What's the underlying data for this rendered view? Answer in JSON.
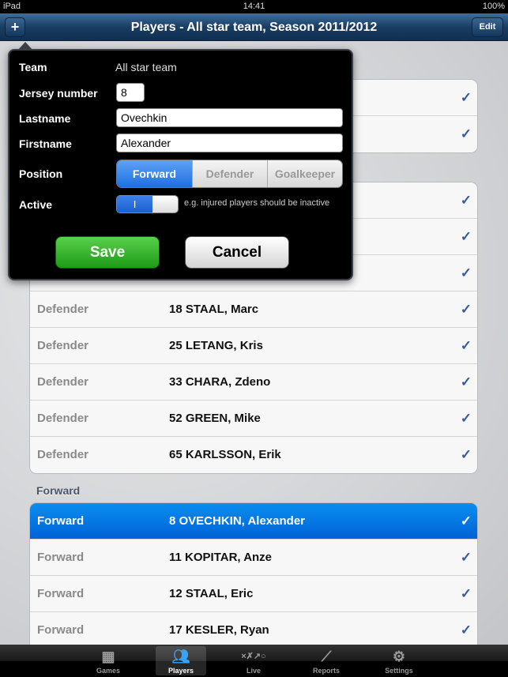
{
  "status": {
    "device": "iPad",
    "time": "14:41",
    "battery": "100%"
  },
  "nav": {
    "title": "Players - All star team, Season 2011/2012",
    "add_label": "+",
    "edit_label": "Edit"
  },
  "group1": [
    {
      "position": "",
      "name": ""
    },
    {
      "position": "",
      "name": ""
    }
  ],
  "group2": [
    {
      "position": "",
      "name": ""
    },
    {
      "position": "",
      "name": ""
    },
    {
      "position": "",
      "name": ""
    },
    {
      "position": "Defender",
      "name": "18 STAAL, Marc"
    },
    {
      "position": "Defender",
      "name": "25 LETANG, Kris"
    },
    {
      "position": "Defender",
      "name": "33 CHARA, Zdeno"
    },
    {
      "position": "Defender",
      "name": "52 GREEN, Mike"
    },
    {
      "position": "Defender",
      "name": "65 KARLSSON, Erik"
    }
  ],
  "forward_header": "Forward",
  "group3": [
    {
      "position": "Forward",
      "name": "8 OVECHKIN, Alexander",
      "selected": true
    },
    {
      "position": "Forward",
      "name": "11 KOPITAR, Anze"
    },
    {
      "position": "Forward",
      "name": "12 STAAL, Eric"
    },
    {
      "position": "Forward",
      "name": "17 KESLER, Ryan"
    }
  ],
  "check": "✓",
  "form": {
    "team_label": "Team",
    "team_value": "All star team",
    "jersey_label": "Jersey number",
    "jersey_value": "8",
    "lastname_label": "Lastname",
    "lastname_value": "Ovechkin",
    "firstname_label": "Firstname",
    "firstname_value": "Alexander",
    "position_label": "Position",
    "positions": [
      "Forward",
      "Defender",
      "Goalkeeper"
    ],
    "position_selected": "Forward",
    "active_label": "Active",
    "active_on": "I",
    "active_hint": "e.g. injured players should be inactive",
    "save": "Save",
    "cancel": "Cancel"
  },
  "tabs": [
    {
      "label": "Games",
      "icon": "calendar-icon"
    },
    {
      "label": "Players",
      "icon": "players-icon",
      "active": true
    },
    {
      "label": "Live",
      "icon": "play-diagram-icon"
    },
    {
      "label": "Reports",
      "icon": "chart-icon"
    },
    {
      "label": "Settings",
      "icon": "gear-icon"
    }
  ]
}
